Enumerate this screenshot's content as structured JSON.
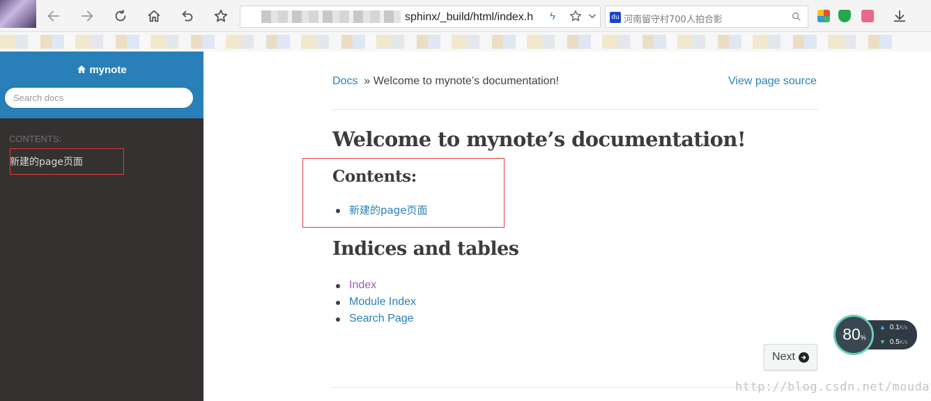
{
  "browser": {
    "url_visible": "sphinx/_build/html/index.h",
    "search_text": "河南留守村700人拍合影",
    "icons": [
      "back-icon",
      "forward-icon",
      "reload-icon",
      "home-icon",
      "undo-icon",
      "star-icon",
      "bolt-icon",
      "dropdown-icon",
      "search-icon",
      "download-icon"
    ]
  },
  "sidebar": {
    "project": "mynote",
    "search_placeholder": "Search docs",
    "caption": "CONTENTS:",
    "items": [
      {
        "label": "新建的page页面"
      }
    ],
    "colors": {
      "header": "#2980b9",
      "background": "#343131"
    }
  },
  "breadcrumb": {
    "root": "Docs",
    "separator": "»",
    "current": "Welcome to mynote’s documentation!",
    "source_link": "View page source"
  },
  "main": {
    "title": "Welcome to mynote’s documentation!",
    "contents_heading": "Contents:",
    "contents_items": [
      {
        "label": "新建的page页面"
      }
    ],
    "indices_heading": "Indices and tables",
    "indices_items": [
      {
        "label": "Index",
        "visited": true
      },
      {
        "label": "Module Index",
        "visited": false
      },
      {
        "label": "Search Page",
        "visited": false
      }
    ],
    "next_label": "Next",
    "link_color": "#2980b9",
    "visited_color": "#9b59b6"
  },
  "overlay": {
    "percent": "80",
    "percent_unit": "%",
    "up_rate": "0.1",
    "down_rate": "0.5",
    "rate_unit": "K/s"
  },
  "watermark": "http://blog.csdn.net/mouday"
}
